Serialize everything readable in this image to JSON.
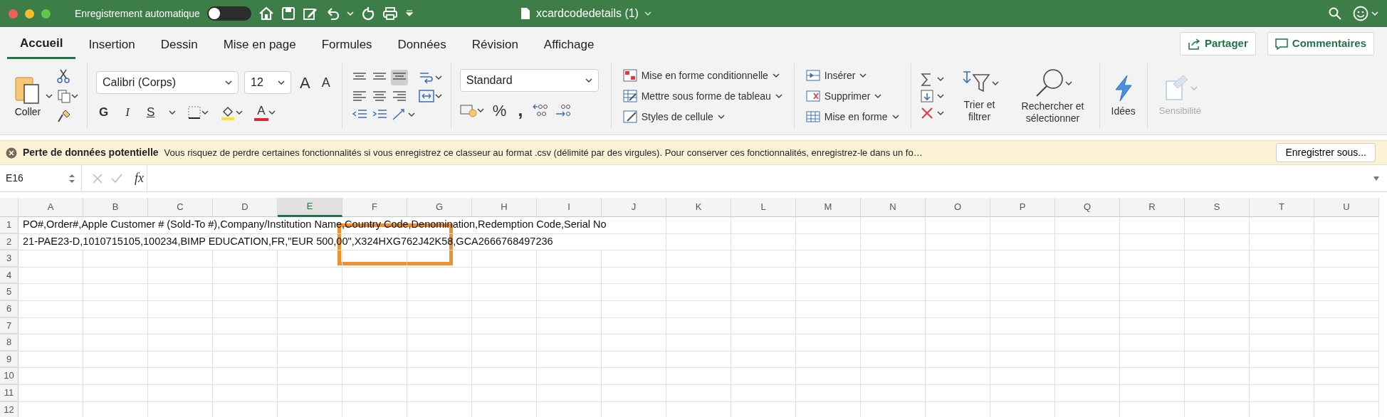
{
  "title_bar": {
    "autosave_label": "Enregistrement automatique",
    "autosave_on": false,
    "document_title": "xcardcodedetails (1)"
  },
  "tabs": [
    {
      "label": "Accueil",
      "selected": true
    },
    {
      "label": "Insertion",
      "selected": false
    },
    {
      "label": "Dessin",
      "selected": false
    },
    {
      "label": "Mise en page",
      "selected": false
    },
    {
      "label": "Formules",
      "selected": false
    },
    {
      "label": "Données",
      "selected": false
    },
    {
      "label": "Révision",
      "selected": false
    },
    {
      "label": "Affichage",
      "selected": false
    }
  ],
  "share_buttons": [
    {
      "kind": "share",
      "label": "Partager"
    },
    {
      "kind": "comments",
      "label": "Commentaires"
    }
  ],
  "ribbon": {
    "paste_label": "Coller",
    "font_name": "Calibri (Corps)",
    "font_size": "12",
    "grow_font": "A",
    "shrink_font": "A",
    "bold": "G",
    "italic": "I",
    "underline": "S",
    "font_color": "A",
    "number_format": "Standard",
    "percent": "%",
    "comma": ",",
    "styles": [
      {
        "kind": "conditional",
        "label": "Mise en forme conditionnelle"
      },
      {
        "kind": "table",
        "label": "Mettre sous forme de tableau"
      },
      {
        "kind": "cellstyle",
        "label": "Styles de cellule"
      }
    ],
    "cells": [
      {
        "kind": "insert",
        "label": "Insérer"
      },
      {
        "kind": "delete",
        "label": "Supprimer"
      },
      {
        "kind": "format",
        "label": "Mise en forme"
      }
    ],
    "sort_filter": "Trier et filtrer",
    "find_select": "Rechercher et sélectionner",
    "ideas": "Idées",
    "sensitivity": {
      "label": "Sensibilité",
      "disabled": true
    }
  },
  "alert": {
    "title": "Perte de données potentielle",
    "message": "Vous risquez de perdre certaines fonctionnalités si vous enregistrez ce classeur au format .csv (délimité par des virgules). Pour conserver ces fonctionnalités, enregistrez-le dans un fo…",
    "button": "Enregistrer sous..."
  },
  "formula_bar": {
    "name_box": "E16",
    "fx": "fx"
  },
  "sheet": {
    "columns": [
      {
        "label": "A",
        "selected": false
      },
      {
        "label": "B",
        "selected": false
      },
      {
        "label": "C",
        "selected": false
      },
      {
        "label": "D",
        "selected": false
      },
      {
        "label": "E",
        "selected": true
      },
      {
        "label": "F",
        "selected": false
      },
      {
        "label": "G",
        "selected": false
      },
      {
        "label": "H",
        "selected": false
      },
      {
        "label": "I",
        "selected": false
      },
      {
        "label": "J",
        "selected": false
      },
      {
        "label": "K",
        "selected": false
      },
      {
        "label": "L",
        "selected": false
      },
      {
        "label": "M",
        "selected": false
      },
      {
        "label": "N",
        "selected": false
      },
      {
        "label": "O",
        "selected": false
      },
      {
        "label": "P",
        "selected": false
      },
      {
        "label": "Q",
        "selected": false
      },
      {
        "label": "R",
        "selected": false
      },
      {
        "label": "S",
        "selected": false
      },
      {
        "label": "T",
        "selected": false
      },
      {
        "label": "U",
        "selected": false
      }
    ],
    "rows": [
      {
        "number": "1",
        "content": "PO#,Order#,Apple Customer # (Sold-To #),Company/Institution Name,Country Code,Denomination,Redemption Code,Serial No"
      },
      {
        "number": "2",
        "content": "21-PAE23-D,1010715105,100234,BIMP EDUCATION,FR,\"EUR 500,00\",X324HXG762J42K58,GCA2666768497236"
      },
      {
        "number": "3"
      },
      {
        "number": "4"
      },
      {
        "number": "5"
      },
      {
        "number": "6"
      },
      {
        "number": "7"
      },
      {
        "number": "8"
      },
      {
        "number": "9"
      },
      {
        "number": "10"
      },
      {
        "number": "11"
      },
      {
        "number": "12"
      }
    ]
  }
}
